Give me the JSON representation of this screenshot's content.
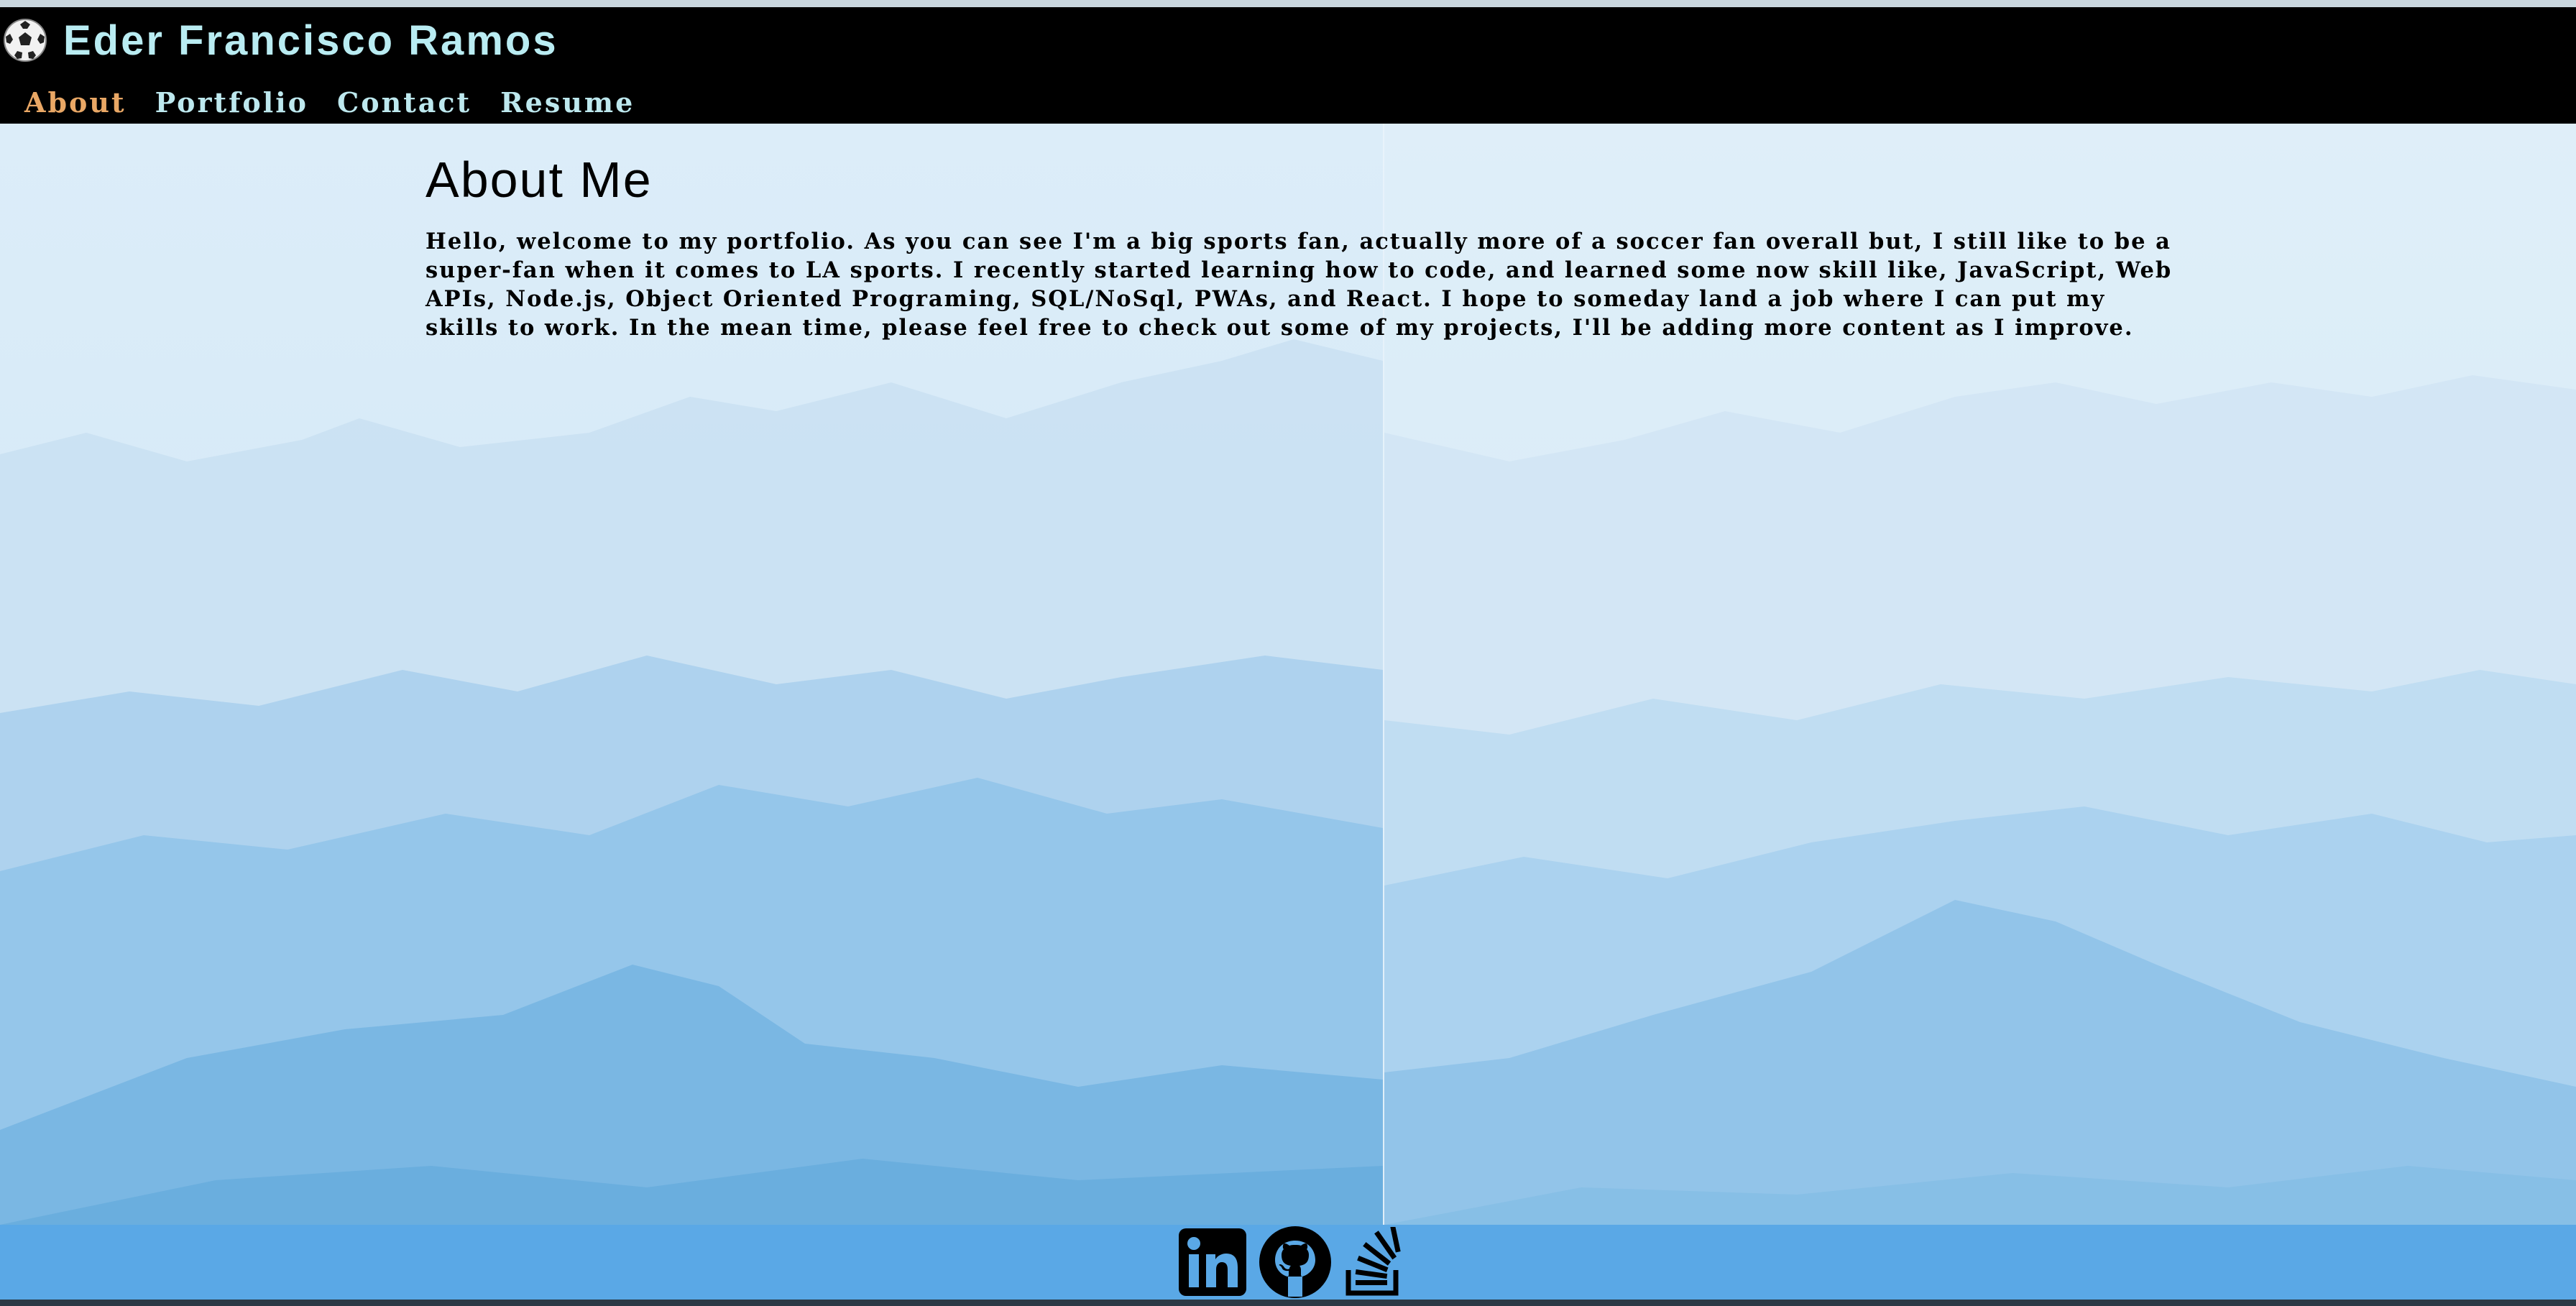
{
  "header": {
    "logo_icon": "soccer-ball-icon",
    "title": "Eder Francisco Ramos",
    "nav": [
      {
        "label": "About",
        "active": true
      },
      {
        "label": "Portfolio",
        "active": false
      },
      {
        "label": "Contact",
        "active": false
      },
      {
        "label": "Resume",
        "active": false
      }
    ]
  },
  "main": {
    "title": "About Me",
    "paragraph": "Hello, welcome to my portfolio. As you can see I'm a big sports fan, actually more of a soccer fan overall but, I still like to be a super-fan when it comes to LA sports. I recently started learning how to code, and learned some now skill like, JavaScript, Web APIs, Node.js, Object Oriented Programing, SQL/NoSql, PWAs, and React. I hope to someday land a job where I can put my skills to work. In the mean time, please feel free to check out some of my projects, I'll be adding more content as I improve."
  },
  "footer": {
    "social_icons": [
      "linkedin-icon",
      "github-icon",
      "stackoverflow-icon"
    ]
  },
  "colors": {
    "header_bg": "#000000",
    "title_color": "#b9ecf2",
    "nav_color": "#bde8ee",
    "nav_active_color": "#e9a765",
    "page_bg": "#dcecf7",
    "footer_bg": "#5aa8e6"
  }
}
